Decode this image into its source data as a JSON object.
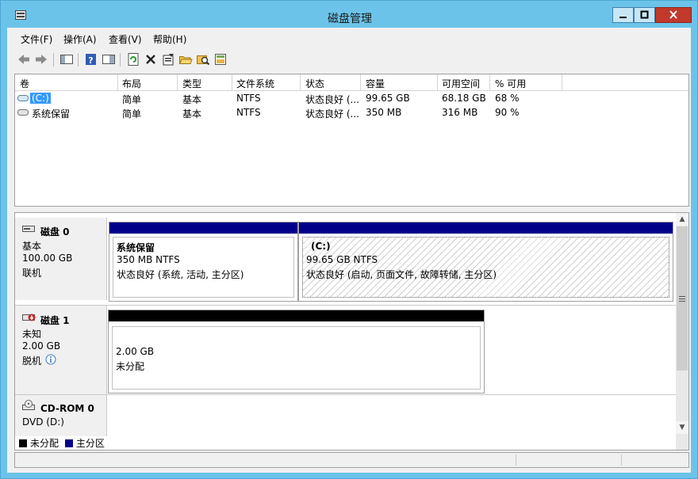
{
  "window": {
    "title": "磁盘管理"
  },
  "menu": [
    "文件(F)",
    "操作(A)",
    "查看(V)",
    "帮助(H)"
  ],
  "toolbar_icons": [
    "back-arrow-icon",
    "forward-arrow-icon",
    "show-hide-tree-icon",
    "help-icon",
    "properties-pane-icon",
    "refresh-icon",
    "delete-icon",
    "properties-icon",
    "open-icon",
    "explore-icon",
    "rescan-icon"
  ],
  "volume_list": {
    "columns": [
      "卷",
      "布局",
      "类型",
      "文件系统",
      "状态",
      "容量",
      "可用空间",
      "% 可用"
    ],
    "rows": [
      {
        "name": "(C:)",
        "layout": "简单",
        "type": "基本",
        "fs": "NTFS",
        "status": "状态良好 (...",
        "capacity": "99.65 GB",
        "free": "68.18 GB",
        "pct": "68 %"
      },
      {
        "name": "系统保留",
        "layout": "简单",
        "type": "基本",
        "fs": "NTFS",
        "status": "状态良好 (...",
        "capacity": "350 MB",
        "free": "316 MB",
        "pct": "90 %"
      }
    ]
  },
  "disks": [
    {
      "name": "磁盘 0",
      "kind": "基本",
      "size": "100.00 GB",
      "state": "联机",
      "partitions": [
        {
          "title": "系统保留",
          "size_fs": "350 MB NTFS",
          "status": "状态良好 (系统, 活动, 主分区)"
        },
        {
          "title": "(C:)",
          "size_fs": "99.65 GB NTFS",
          "status": "状态良好 (启动, 页面文件, 故障转储, 主分区)"
        }
      ]
    },
    {
      "name": "磁盘 1",
      "kind": "未知",
      "size": "2.00 GB",
      "state": "脱机",
      "partitions": [
        {
          "size": "2.00 GB",
          "status": "未分配"
        }
      ]
    },
    {
      "name": "CD-ROM 0",
      "kind": "DVD (D:)"
    }
  ],
  "legend": {
    "unallocated": "未分配",
    "primary": "主分区"
  },
  "colors": {
    "primary": "#00008b",
    "unallocated": "#000000",
    "titlebar": "#6cc3e9",
    "selection": "#3399ff"
  }
}
